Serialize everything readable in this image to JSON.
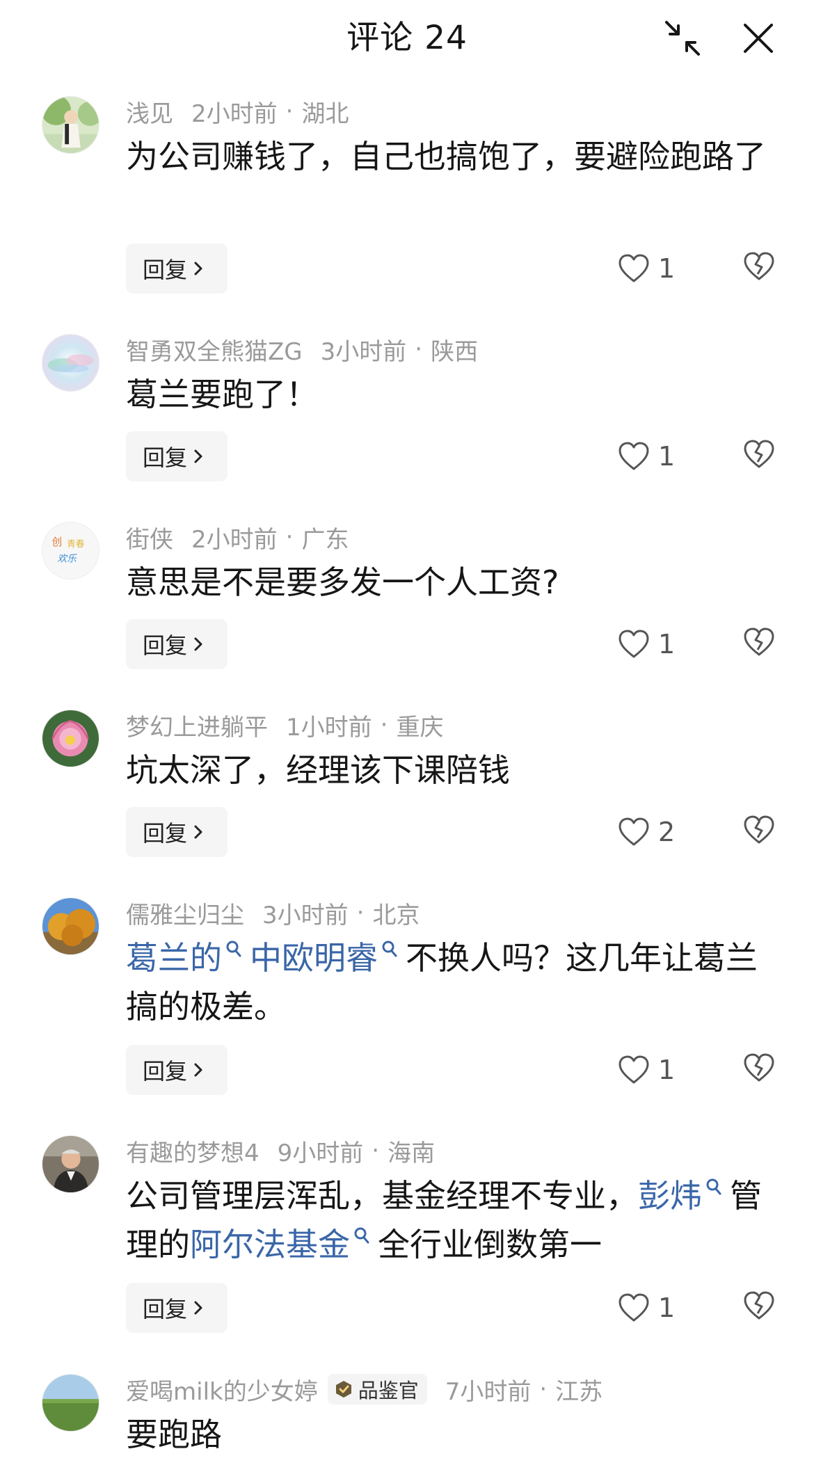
{
  "header": {
    "title": "评论 24",
    "collapse_icon": "collapse-arrows-icon",
    "close_icon": "close-icon"
  },
  "comments": [
    {
      "user": "浅见",
      "time": "2小时前",
      "location": "湖北",
      "text": "为公司赚钱了，自己也搞饱了，要避险跑路了",
      "likes": "1",
      "reply_label": "回复"
    },
    {
      "user": "智勇双全熊猫ZG",
      "time": "3小时前",
      "location": "陕西",
      "text": "葛兰要跑了！",
      "likes": "1",
      "reply_label": "回复"
    },
    {
      "user": "街侠",
      "time": "2小时前",
      "location": "广东",
      "text": "意思是不是要多发一个人工资?",
      "likes": "1",
      "reply_label": "回复",
      "avatar_text": [
        "创",
        "青春",
        "欢乐"
      ]
    },
    {
      "user": "梦幻上进躺平",
      "time": "1小时前",
      "location": "重庆",
      "text": "坑太深了，经理该下课陪钱",
      "likes": "2",
      "reply_label": "回复"
    },
    {
      "user": "儒雅尘归尘",
      "time": "3小时前",
      "location": "北京",
      "link1": "葛兰的",
      "link2": "中欧明睿",
      "text_after": "不换人吗？这几年让葛兰搞的极差。",
      "likes": "1",
      "reply_label": "回复"
    },
    {
      "user": "有趣的梦想4",
      "time": "9小时前",
      "location": "海南",
      "text_before": "公司管理层浑乱，基金经理不专业，",
      "link1": "彭炜",
      "text_mid": "管理的",
      "link2": "阿尔法基金",
      "text_after": "全行业倒数第一",
      "likes": "1",
      "reply_label": "回复"
    },
    {
      "user": "爱喝milk的少女婷",
      "badge": "品鉴官",
      "time": "7小时前",
      "location": "江苏",
      "text": "要跑路"
    }
  ],
  "separator": "·",
  "colors": {
    "link": "#3a66a8",
    "meta": "#9a9a9a",
    "reply_bg": "#f5f5f5"
  }
}
